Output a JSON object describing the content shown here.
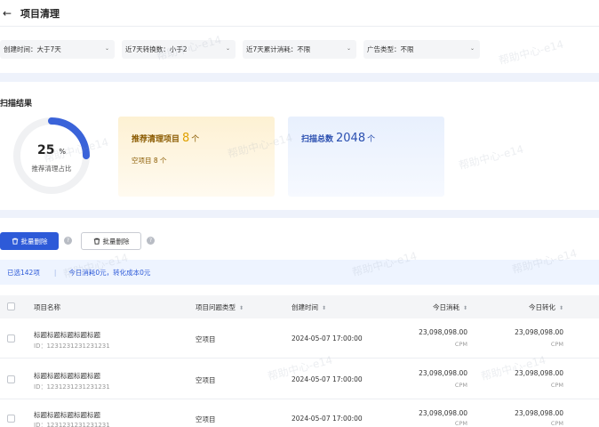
{
  "header": {
    "back_icon": "arrow-left-icon",
    "title": "项目清理"
  },
  "filters": [
    {
      "label": "创建时间：大于7天"
    },
    {
      "label": "近7天转换数：小于2"
    },
    {
      "label": "近7天累计消耗：不限"
    },
    {
      "label": "广告类型：不限"
    }
  ],
  "scan": {
    "title": "扫描结果",
    "ring": {
      "percent": 25,
      "percent_text": "25",
      "unit": "%",
      "label": "推荐清理占比",
      "color": "#3a63d9",
      "track_color": "#f0f1f3"
    },
    "recommend": {
      "title": "推荐清理项目",
      "count": "8",
      "unit": "个",
      "sub": "空项目 8 个"
    },
    "total": {
      "title": "扫描总数",
      "count": "2048",
      "unit": "个"
    }
  },
  "actions": {
    "primary_label": "批量删除",
    "secondary_label": "批量删除",
    "trash_icon": "trash-icon",
    "help_icon": "help-circle-icon"
  },
  "selection": {
    "selected": "已选142项",
    "summary": "今日消耗0元，转化成本0元"
  },
  "table": {
    "columns": {
      "name": "项目名称",
      "type": "项目问题类型",
      "created": "创建时间",
      "spend": "今日消耗",
      "conv": "今日转化"
    },
    "rows": [
      {
        "name": "标题标题标题标题标题",
        "id": "ID：123123123123123​1",
        "type": "空项目",
        "created": "2024-05-07 17:00:00",
        "spend": "23,098,098.00",
        "spend_unit": "CPM",
        "conv": "23,098,098.00",
        "conv_unit": "CPM"
      },
      {
        "name": "标题标题标题标题标题",
        "id": "ID：1231231231231231",
        "type": "空项目",
        "created": "2024-05-07 17:00:00",
        "spend": "23,098,098.00",
        "spend_unit": "CPM",
        "conv": "23,098,098.00",
        "conv_unit": "CPM"
      },
      {
        "name": "标题标题标题标题标题",
        "id": "ID：1231231231231231",
        "type": "空项目",
        "created": "2024-05-07 17:00:00",
        "spend": "23,098,098.00",
        "spend_unit": "CPM",
        "conv": "23,098,098.00",
        "conv_unit": "CPM"
      }
    ]
  },
  "watermark": "帮助中心-e14",
  "colors": {
    "primary": "#2d5ad8",
    "warning": "#e0a100"
  }
}
